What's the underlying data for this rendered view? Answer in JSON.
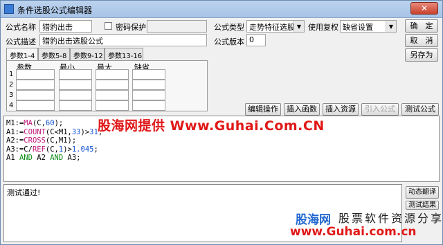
{
  "window": {
    "title": "条件选股公式编辑器",
    "close_label": "✕"
  },
  "form": {
    "name_label": "公式名称",
    "name_value": "猎豹出击",
    "password_label": "密码保护",
    "desc_label": "公式描述",
    "desc_value": "猎豹出击选股公式",
    "type_label": "公式类型",
    "type_value": "走势特征选股",
    "version_label": "公式版本",
    "version_value": "0",
    "restore_label": "使用复权",
    "restore_value": "缺省设置"
  },
  "buttons": {
    "confirm": "确　定",
    "cancel": "取　消",
    "save_as": "另存为",
    "edit_ops": "编辑操作",
    "insert_func": "插入函数",
    "insert_res": "插入资源",
    "import_formula": "引入公式",
    "test_formula": "测试公式",
    "dynamic_translate": "动态翻译",
    "test_result": "测试结果"
  },
  "param_tabs": [
    "参数1-4",
    "参数5-8",
    "参数9-12",
    "参数13-16"
  ],
  "param_headers": [
    "参数",
    "最小",
    "最大",
    "缺省"
  ],
  "param_rows": [
    "1",
    "2",
    "3",
    "4"
  ],
  "code_lines": [
    [
      {
        "t": "M1:=",
        "c": "id"
      },
      {
        "t": "MA",
        "c": "fn"
      },
      {
        "t": "(C,",
        "c": "id"
      },
      {
        "t": "60",
        "c": "num"
      },
      {
        "t": ");",
        "c": "id"
      }
    ],
    [
      {
        "t": "A1:=",
        "c": "id"
      },
      {
        "t": "COUNT",
        "c": "fn"
      },
      {
        "t": "(C<M1,",
        "c": "id"
      },
      {
        "t": "33",
        "c": "num"
      },
      {
        "t": ")",
        "c": "id"
      },
      {
        "t": ">",
        "c": "id"
      },
      {
        "t": "31",
        "c": "num"
      },
      {
        "t": ";",
        "c": "id"
      }
    ],
    [
      {
        "t": "A2:=",
        "c": "id"
      },
      {
        "t": "CROSS",
        "c": "fn"
      },
      {
        "t": "(C,M1);",
        "c": "id"
      }
    ],
    [
      {
        "t": "A3:=C/",
        "c": "id"
      },
      {
        "t": "REF",
        "c": "fn"
      },
      {
        "t": "(C,",
        "c": "id"
      },
      {
        "t": "1",
        "c": "num"
      },
      {
        "t": ")>",
        "c": "id"
      },
      {
        "t": "1.045",
        "c": "num"
      },
      {
        "t": ";",
        "c": "id"
      }
    ],
    [
      {
        "t": "A1 ",
        "c": "id"
      },
      {
        "t": "AND",
        "c": "kw"
      },
      {
        "t": " A2 ",
        "c": "id"
      },
      {
        "t": "AND",
        "c": "kw"
      },
      {
        "t": " A3;",
        "c": "id"
      }
    ]
  ],
  "output_text": "测试通过!",
  "watermark": {
    "banner": "股海网提供 Www.Guhai.Com.CN",
    "brand": "股海网",
    "slogan": "股票软件资源分享",
    "url": "www.Guhai.com.cn"
  }
}
